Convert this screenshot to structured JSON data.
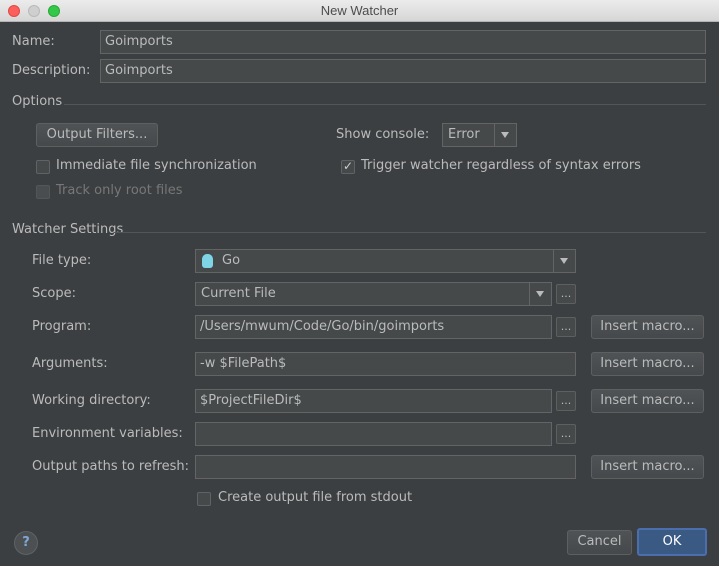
{
  "window": {
    "title": "New Watcher"
  },
  "name": {
    "label": "Name:",
    "value": "Goimports"
  },
  "description": {
    "label": "Description:",
    "value": "Goimports"
  },
  "options": {
    "section_title": "Options",
    "output_filters_label": "Output Filters...",
    "show_console_label": "Show console:",
    "show_console_value": "Error",
    "immediate_sync_label": "Immediate file synchronization",
    "immediate_sync_checked": false,
    "trigger_label": "Trigger watcher regardless of syntax errors",
    "trigger_checked": true,
    "track_root_label": "Track only root files",
    "track_root_checked": false
  },
  "watcher": {
    "section_title": "Watcher Settings",
    "file_type_label": "File type:",
    "file_type_value": "Go",
    "scope_label": "Scope:",
    "scope_value": "Current File",
    "program_label": "Program:",
    "program_value": "/Users/mwum/Code/Go/bin/goimports",
    "arguments_label": "Arguments:",
    "arguments_value": "-w $FilePath$",
    "working_dir_label": "Working directory:",
    "working_dir_value": "$ProjectFileDir$",
    "env_label": "Environment variables:",
    "env_value": "",
    "output_paths_label": "Output paths to refresh:",
    "output_paths_value": "",
    "create_output_label": "Create output file from stdout",
    "create_output_checked": false,
    "insert_macro_label": "Insert macro...",
    "browse_label": "..."
  },
  "footer": {
    "help_label": "?",
    "cancel_label": "Cancel",
    "ok_label": "OK"
  },
  "colors": {
    "background": "#3c3f41",
    "accent": "#4b6eaf",
    "text": "#bbbbbb"
  }
}
